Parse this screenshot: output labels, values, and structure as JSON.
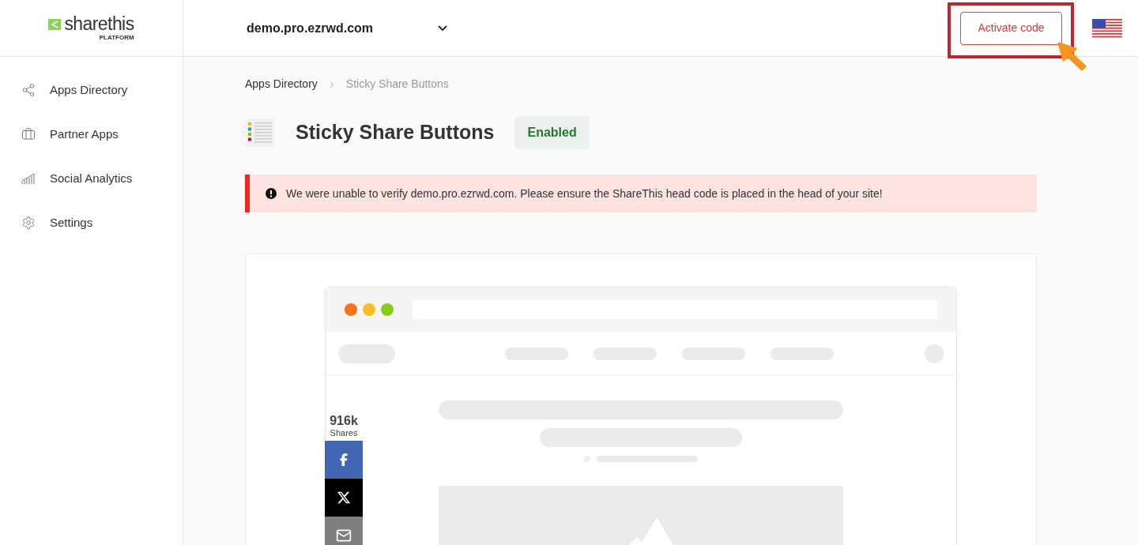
{
  "logo": {
    "name": "sharethis",
    "sub": "PLATFORM"
  },
  "site_selector": {
    "value": "demo.pro.ezrwd.com"
  },
  "activate_button": {
    "label": "Activate code",
    "highlighted": true
  },
  "sidebar": {
    "items": [
      {
        "kind": "share",
        "label": "Apps Directory"
      },
      {
        "kind": "briefcase",
        "label": "Partner Apps"
      },
      {
        "kind": "chart",
        "label": "Social Analytics"
      },
      {
        "kind": "settings",
        "label": "Settings"
      }
    ]
  },
  "breadcrumb": [
    "Apps Directory",
    "Sticky Share Buttons"
  ],
  "app": {
    "title": "Sticky Share Buttons",
    "status": "Enabled"
  },
  "alert": {
    "message": "We were unable to verify demo.pro.ezrwd.com. Please ensure the ShareThis head code is placed in the head of your site!"
  },
  "share_bar": {
    "count": "916k",
    "count_label": "Shares",
    "networks": [
      {
        "kind": "facebook"
      },
      {
        "kind": "x"
      },
      {
        "kind": "email"
      }
    ]
  }
}
